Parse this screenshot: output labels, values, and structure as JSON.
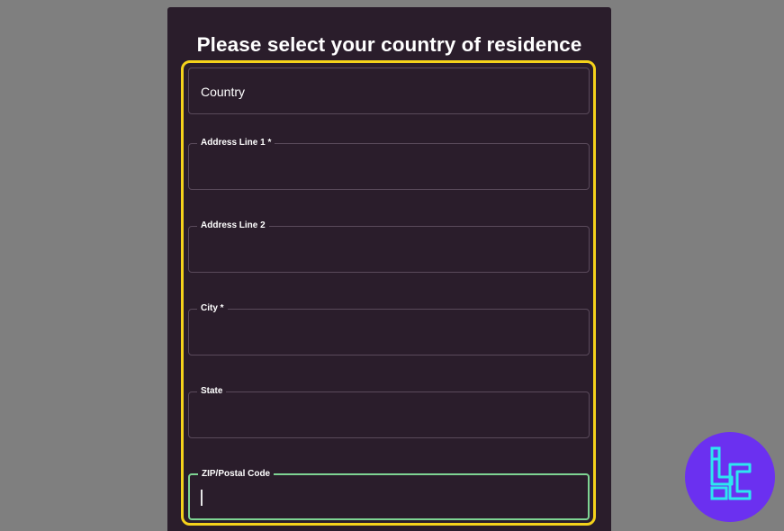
{
  "form": {
    "title": "Please select your country of residence",
    "fields": [
      {
        "label": "",
        "placeholder": "Country",
        "value": ""
      },
      {
        "label": "Address Line 1 *",
        "placeholder": "",
        "value": ""
      },
      {
        "label": "Address Line 2",
        "placeholder": "",
        "value": ""
      },
      {
        "label": "City *",
        "placeholder": "",
        "value": ""
      },
      {
        "label": "State",
        "placeholder": "",
        "value": ""
      },
      {
        "label": "ZIP/Postal Code",
        "placeholder": "",
        "value": ""
      }
    ]
  },
  "colors": {
    "panel_bg": "#2a1d2b",
    "highlight": "#f5d21b",
    "focus_border": "#7ed493",
    "logo_bg": "#6b30f0",
    "logo_accent": "#2ee6f0"
  },
  "icons": {
    "watermark": "brand-logo-icon"
  }
}
